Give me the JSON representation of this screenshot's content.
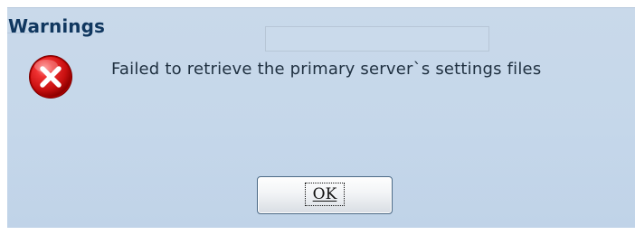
{
  "dialog": {
    "title": "Warnings",
    "message": "Failed to retrieve the primary server`s settings files",
    "icon": "error-icon",
    "ok_label": "OK"
  },
  "colors": {
    "background": "#c5d7ea",
    "title": "#10375f",
    "icon_red": "#d71a1a",
    "button_border": "#4b6985"
  }
}
